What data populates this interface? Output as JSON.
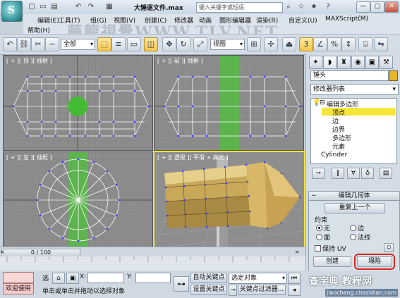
{
  "titlebar": {
    "doc_title": "大锤逐文件.max",
    "search_placeholder": "键入关键字或短语",
    "minimize": "—",
    "maximize": "□",
    "close": "✕"
  },
  "menu": {
    "items": [
      "编辑(E)",
      "工具(T)",
      "组(G)",
      "视图(V)",
      "创建(C)",
      "修改器",
      "动画",
      "图形编辑器",
      "渲染(R)",
      "自定义(U)",
      "MAXScript(M)"
    ],
    "help": "帮助(H)"
  },
  "watermark": "藤龍視覺WWW.TLV.NET",
  "toolbar": {
    "selection_filter": "全部",
    "ref_coord": "视图",
    "snap_label": "3"
  },
  "viewports": {
    "top_label": "[ + ][ 顶 ][ 线框 ]",
    "front_label": "[ + ][ 前 ][ 线框 ]",
    "left_label": "[ + ][ 左 ][ 线框 ]",
    "persp_label": "[ + ][ 透视 ][ 平滑 + 高光 ]"
  },
  "panel": {
    "object_name": "锤头",
    "object_color": "#e6b62a",
    "modifier_list": "修改器列表",
    "stack": {
      "root": "编辑多边形",
      "subs": [
        "顶点",
        "边",
        "边界",
        "多边形",
        "元素"
      ],
      "base": "Cylinder"
    },
    "rollout": {
      "title": "编辑几何体",
      "repeat_last": "重复上一个",
      "constraints_label": "约束",
      "opt_none": "无",
      "opt_edge": "边",
      "opt_face": "面",
      "opt_normal": "法线",
      "preserve_uv": "保持 UV",
      "create": "创建",
      "collapse": "塌陷"
    }
  },
  "timeline": {
    "slider": "0 / 100"
  },
  "status": {
    "select_text": "选",
    "x_label": "X:",
    "y_label": "Y:",
    "welcome": "欢迎使用",
    "prompt": "单击或单击并拖动以选择对象",
    "auto_key": "自动关键点",
    "set_key": "设置关键点",
    "selected_object": "选定对象",
    "key_filter": "关键点过滤器...",
    "site_logo": "查字典 教程网",
    "site_url": "jiaocheng.chazidian.com"
  }
}
